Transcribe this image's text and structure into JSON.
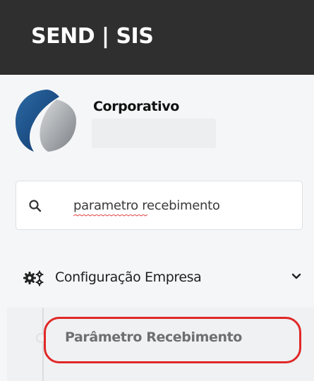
{
  "header": {
    "brand": "SEND | SIS"
  },
  "profile": {
    "name": "Corporativo",
    "logo_icon": "company-logo-icon"
  },
  "search": {
    "value": "parametro recebimento",
    "icon": "search-icon"
  },
  "menu": {
    "section": {
      "label": "Configuração Empresa",
      "icon": "gears-icon",
      "expanded": true
    },
    "items": [
      {
        "label": "Parâmetro Recebimento",
        "highlighted": true
      }
    ]
  },
  "colors": {
    "header_bg": "#2f2f2f",
    "highlight": "#e02828",
    "sidebar_bg": "#f5f6f7"
  }
}
